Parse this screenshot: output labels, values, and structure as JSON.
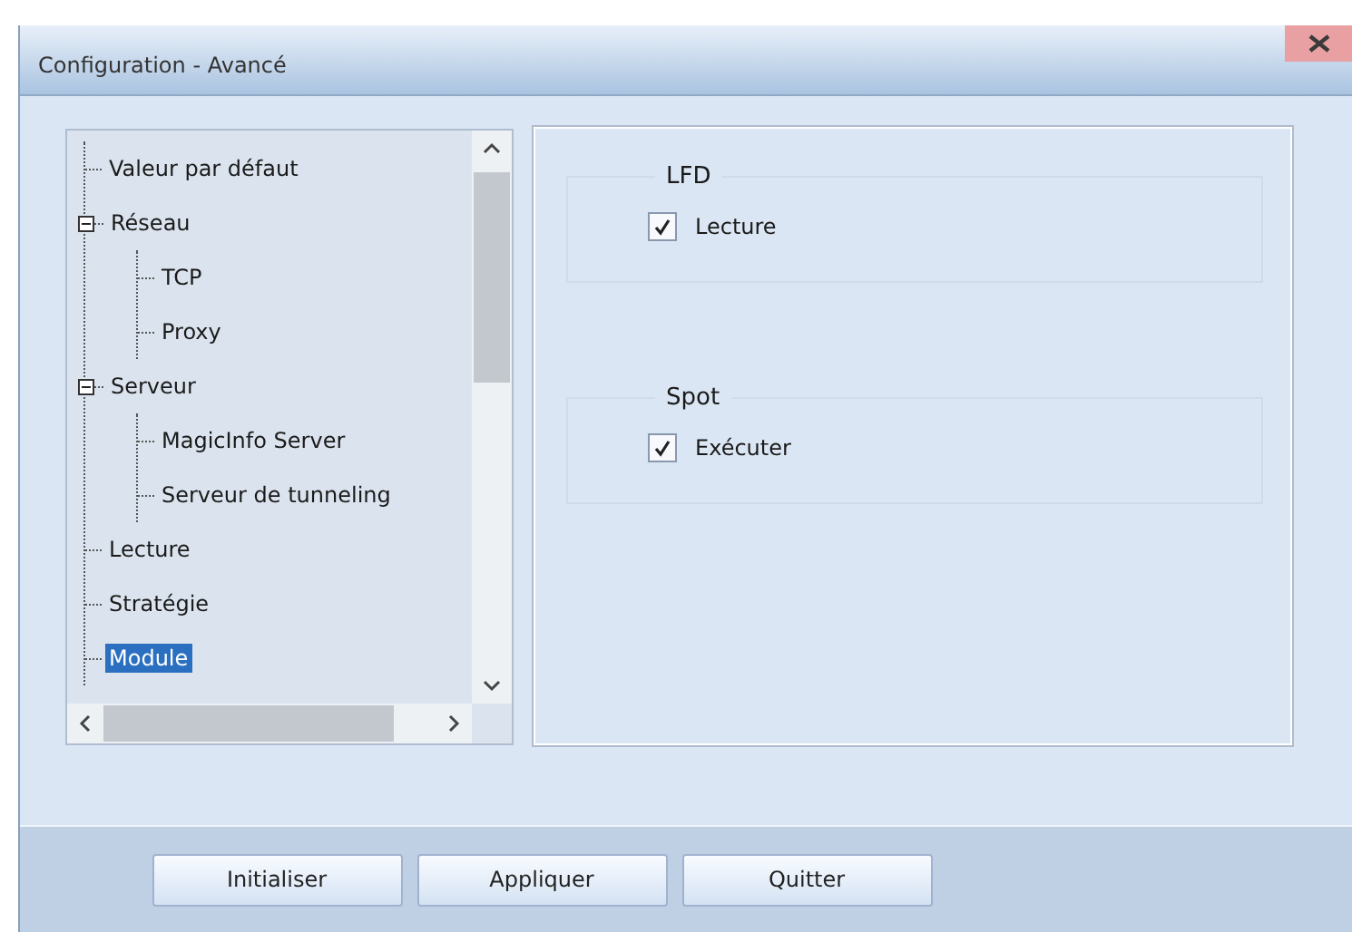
{
  "window": {
    "title": "Configuration - Avancé"
  },
  "tree": {
    "items": [
      {
        "label": "Valeur par défaut",
        "selected": false
      },
      {
        "label": "Réseau",
        "selected": false,
        "expanded": true,
        "children": [
          {
            "label": "TCP",
            "selected": false
          },
          {
            "label": "Proxy",
            "selected": false
          }
        ]
      },
      {
        "label": "Serveur",
        "selected": false,
        "expanded": true,
        "children": [
          {
            "label": "MagicInfo Server",
            "selected": false
          },
          {
            "label": "Serveur de tunneling",
            "selected": false
          }
        ]
      },
      {
        "label": "Lecture",
        "selected": false
      },
      {
        "label": "Stratégie",
        "selected": false
      },
      {
        "label": "Module",
        "selected": true
      }
    ]
  },
  "groups": [
    {
      "title": "LFD",
      "options": [
        {
          "label": "Lecture",
          "checked": true
        }
      ]
    },
    {
      "title": "Spot",
      "options": [
        {
          "label": "Exécuter",
          "checked": true
        }
      ]
    }
  ],
  "buttons": [
    "Initialiser",
    "Appliquer",
    "Quitter"
  ]
}
